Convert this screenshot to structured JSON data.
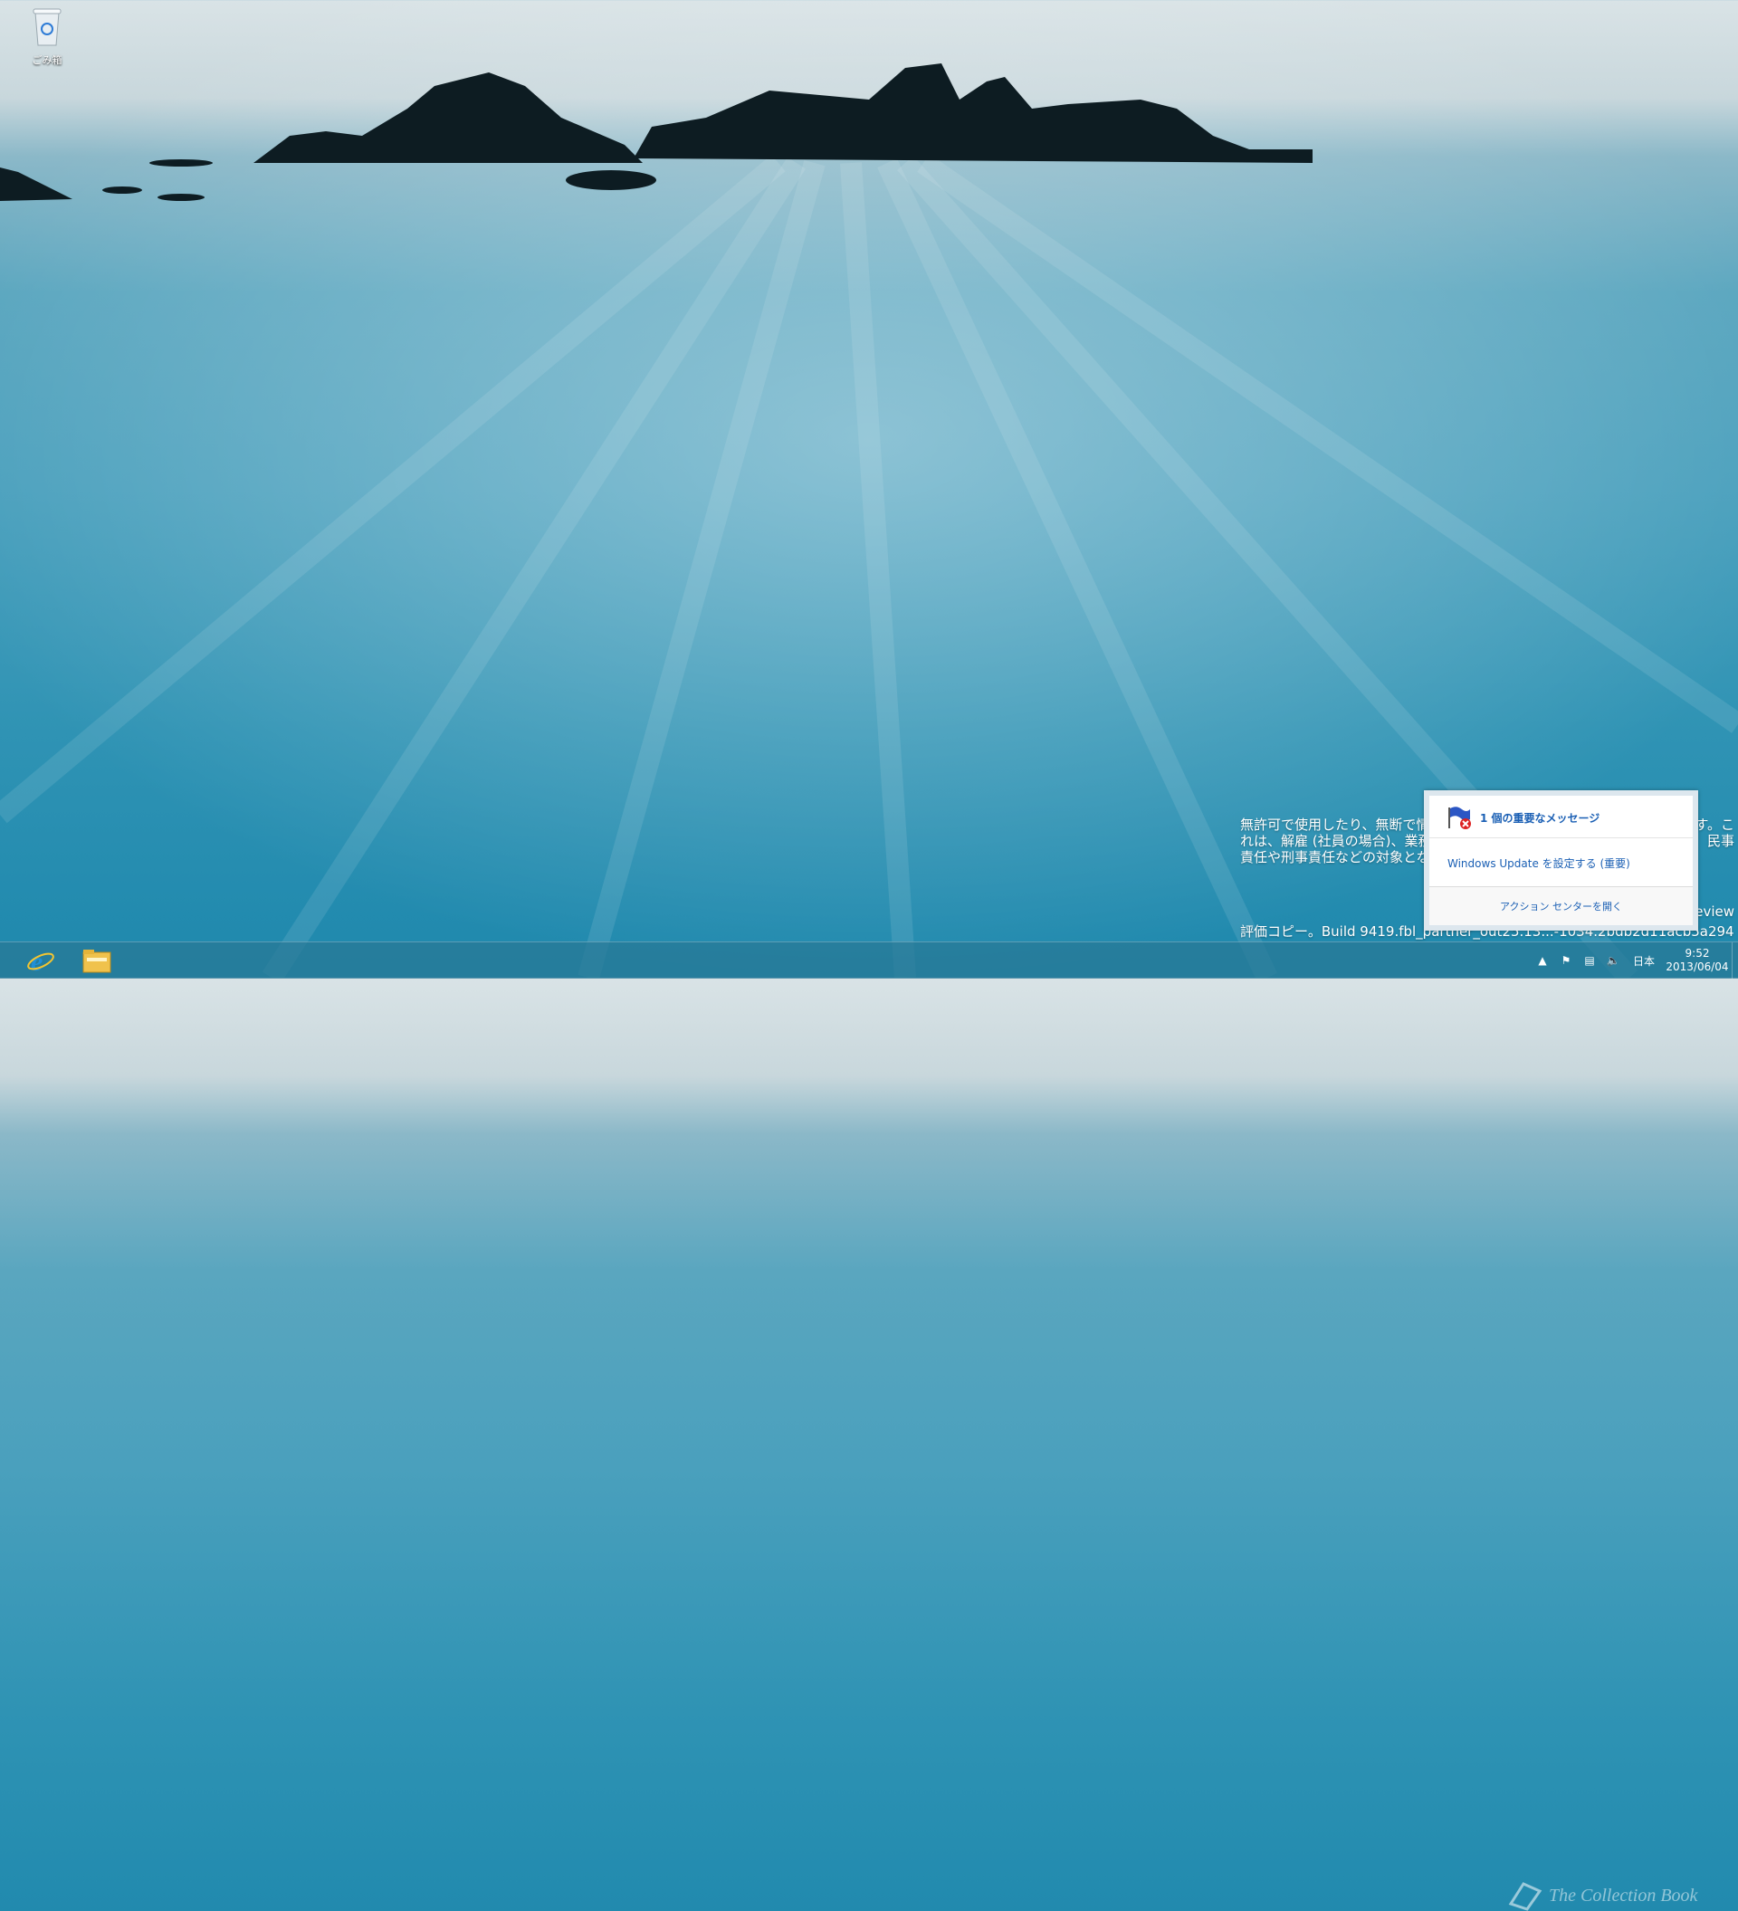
{
  "desktop": {
    "icons": [
      {
        "label": "ごみ箱",
        "icon": "recycle-bin-icon"
      }
    ]
  },
  "watermark": {
    "line1": "無許可で使用したり、無断で情報",
    "line1_end": "ます。こ",
    "line2": "れは、解雇 (社員の場合)、業務",
    "line2_end": "民事",
    "line3": "責任や刑事責任などの対象となり",
    "preview": "eview",
    "build": "評価コピー。Build 9419.fbl_partner_out25.13...-1034.2bdb2d11acb5a294"
  },
  "notification": {
    "title": "1 個の重要なメッセージ",
    "message": "Windows Update を設定する (重要)",
    "footer": "アクション センターを開く",
    "icon": "action-center-flag-icon"
  },
  "taskbar": {
    "pinned": [
      {
        "name": "internet-explorer-icon",
        "color": "#1f8fd8"
      },
      {
        "name": "file-explorer-icon",
        "color": "#f0c24c"
      }
    ],
    "tray": {
      "language": "日本",
      "time": "9:52",
      "date": "2013/06/04"
    }
  },
  "site_watermark": "The Collection Book"
}
